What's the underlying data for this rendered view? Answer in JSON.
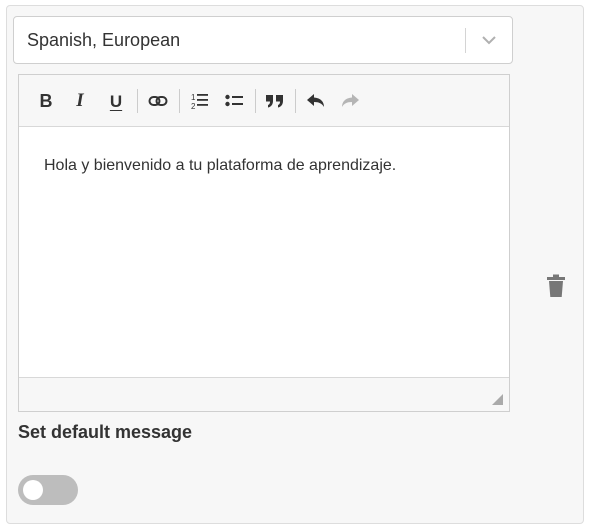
{
  "language_select": {
    "selected": "Spanish, European",
    "chevron_icon": "chevron-down-icon"
  },
  "editor": {
    "toolbar": {
      "bold_glyph": "B",
      "italic_glyph": "I",
      "underline_glyph": "U",
      "icons": [
        "bold-icon",
        "italic-icon",
        "underline-icon",
        "link-icon",
        "ordered-list-icon",
        "bullet-list-icon",
        "blockquote-icon",
        "undo-icon",
        "redo-icon"
      ]
    },
    "content": "Hola y bienvenido a tu plataforma de aprendizaje."
  },
  "default_message": {
    "label": "Set default message",
    "enabled": false
  },
  "delete_icon": "trash-icon",
  "colors": {
    "panel_bg": "#f7f7f7",
    "text": "#333333",
    "toggle_off": "#bdbdbd",
    "icon_muted": "#777777",
    "redo_disabled": "#b5b5b5"
  }
}
